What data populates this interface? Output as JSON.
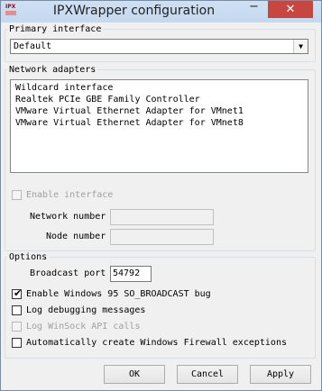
{
  "window": {
    "title": "IPXWrapper configuration",
    "icon_text": "IPX"
  },
  "titlebar": {
    "minimize_glyph": "−",
    "close_glyph": "✕"
  },
  "primary_interface": {
    "group_label": "Primary interface",
    "selected": "Default"
  },
  "network_adapters": {
    "group_label": "Network adapters",
    "items": [
      "Wildcard interface",
      "Realtek PCIe GBE Family Controller",
      "VMware Virtual Ethernet Adapter for VMnet1",
      "VMware Virtual Ethernet Adapter for VMnet8"
    ],
    "enable_interface_label": "Enable interface",
    "network_number_label": "Network number",
    "node_number_label": "Node number",
    "network_number_value": "",
    "node_number_value": ""
  },
  "options": {
    "group_label": "Options",
    "broadcast_port_label": "Broadcast port",
    "broadcast_port_value": "54792",
    "win95_bcast_label": "Enable Windows 95 SO_BROADCAST bug",
    "win95_bcast_checked": true,
    "log_debug_label": "Log debugging messages",
    "log_debug_checked": false,
    "log_winsock_label": "Log WinSock API calls",
    "log_winsock_checked": false,
    "firewall_label": "Automatically create Windows Firewall exceptions",
    "firewall_checked": false
  },
  "buttons": {
    "ok": "OK",
    "cancel": "Cancel",
    "apply": "Apply"
  }
}
